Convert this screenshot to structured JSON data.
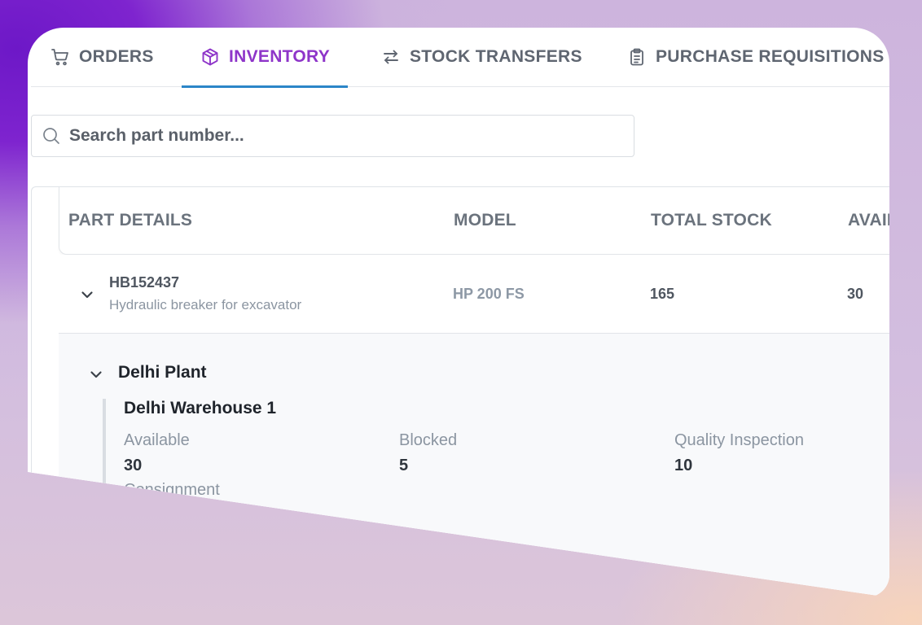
{
  "tabs": [
    {
      "label": "ORDERS",
      "icon": "cart-icon",
      "active": false
    },
    {
      "label": "INVENTORY",
      "icon": "box-icon",
      "active": true
    },
    {
      "label": "STOCK TRANSFERS",
      "icon": "transfer-arrows-icon",
      "active": false
    },
    {
      "label": "PURCHASE REQUISITIONS",
      "icon": "clipboard-icon",
      "active": false
    }
  ],
  "search": {
    "placeholder": "Search part number...",
    "value": ""
  },
  "table": {
    "headers": [
      "PART DETAILS",
      "MODEL",
      "TOTAL STOCK",
      "AVAIL"
    ],
    "rows": [
      {
        "part_number": "HB152437",
        "description": "Hydraulic breaker for excavator",
        "model": "HP 200 FS",
        "total_stock": "165",
        "available": "30"
      }
    ]
  },
  "expanded": {
    "plant": "Delhi Plant",
    "warehouse": "Delhi Warehouse 1",
    "stats": [
      {
        "label": "Available",
        "value": "30"
      },
      {
        "label": "Blocked",
        "value": "5"
      },
      {
        "label": "Quality Inspection",
        "value": "10"
      },
      {
        "label": "Consignment",
        "value": ""
      }
    ]
  },
  "colors": {
    "accent": "#8e35c9",
    "tab_underline": "#2b86c8",
    "text_muted": "#8b95a1"
  }
}
